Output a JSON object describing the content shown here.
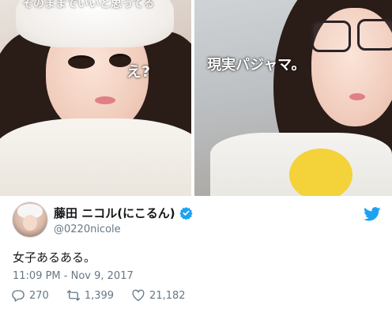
{
  "media": {
    "left_caption": "え?",
    "right_caption": "現実パジャマ。",
    "top_faded_caption": "そのままでいいと思ってる"
  },
  "tweet": {
    "display_name": "藤田 ニコル(にこるん)",
    "handle": "@0220nicole",
    "text": "女子あるある。",
    "timestamp": "11:09 PM - Nov 9, 2017",
    "replies": "270",
    "retweets": "1,399",
    "likes": "21,182"
  },
  "icons": {
    "verified": "verified-badge-icon",
    "brand": "twitter-bird-icon",
    "reply": "reply-icon",
    "retweet": "retweet-icon",
    "like": "heart-icon"
  },
  "colors": {
    "twitter_blue": "#1da1f2",
    "secondary_text": "#657786",
    "primary_text": "#14171a"
  }
}
